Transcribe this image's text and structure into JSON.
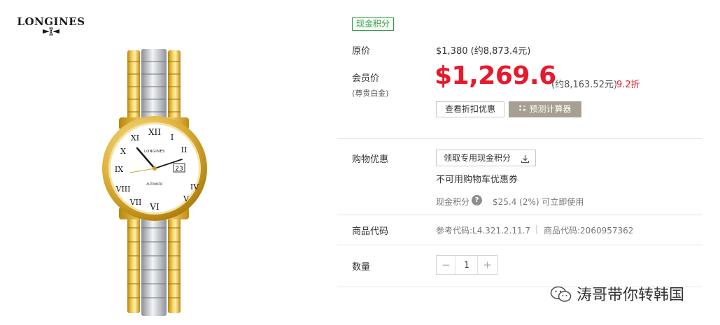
{
  "brand": {
    "name": "LONGINES"
  },
  "product": {
    "image_alt": "watch"
  },
  "cash_tag": "现金积分",
  "original_price": {
    "label": "原价",
    "value": "$1,380 (约8,873.4元)"
  },
  "member_price": {
    "label": "会员价",
    "tier": "(尊贵白金)",
    "value": "$1,269.6",
    "converted": "(约8,163.52元)",
    "discount": "9.2折"
  },
  "buttons": {
    "view_discount": "查看折扣优惠",
    "calc": "预测计算器",
    "coupon": "领取专用现金积分"
  },
  "shopping": {
    "label": "购物优惠",
    "no_coupon": "不可用购物车优惠券",
    "points_label": "现金积分",
    "help": "?",
    "points_value": "$25.4 (2%) 可立即使用"
  },
  "codes": {
    "label": "商品代码",
    "ref": "参考代码:L4.321.2.11.7",
    "product": "商品代码:2060957362"
  },
  "quantity": {
    "label": "数量",
    "value": "1",
    "minus": "−",
    "plus": "+"
  },
  "watermark": {
    "text": "涛哥带你转韩国"
  },
  "colors": {
    "price_red": "#e8192c",
    "tag_green": "#2f9a44",
    "calc_button": "#a79f92"
  }
}
